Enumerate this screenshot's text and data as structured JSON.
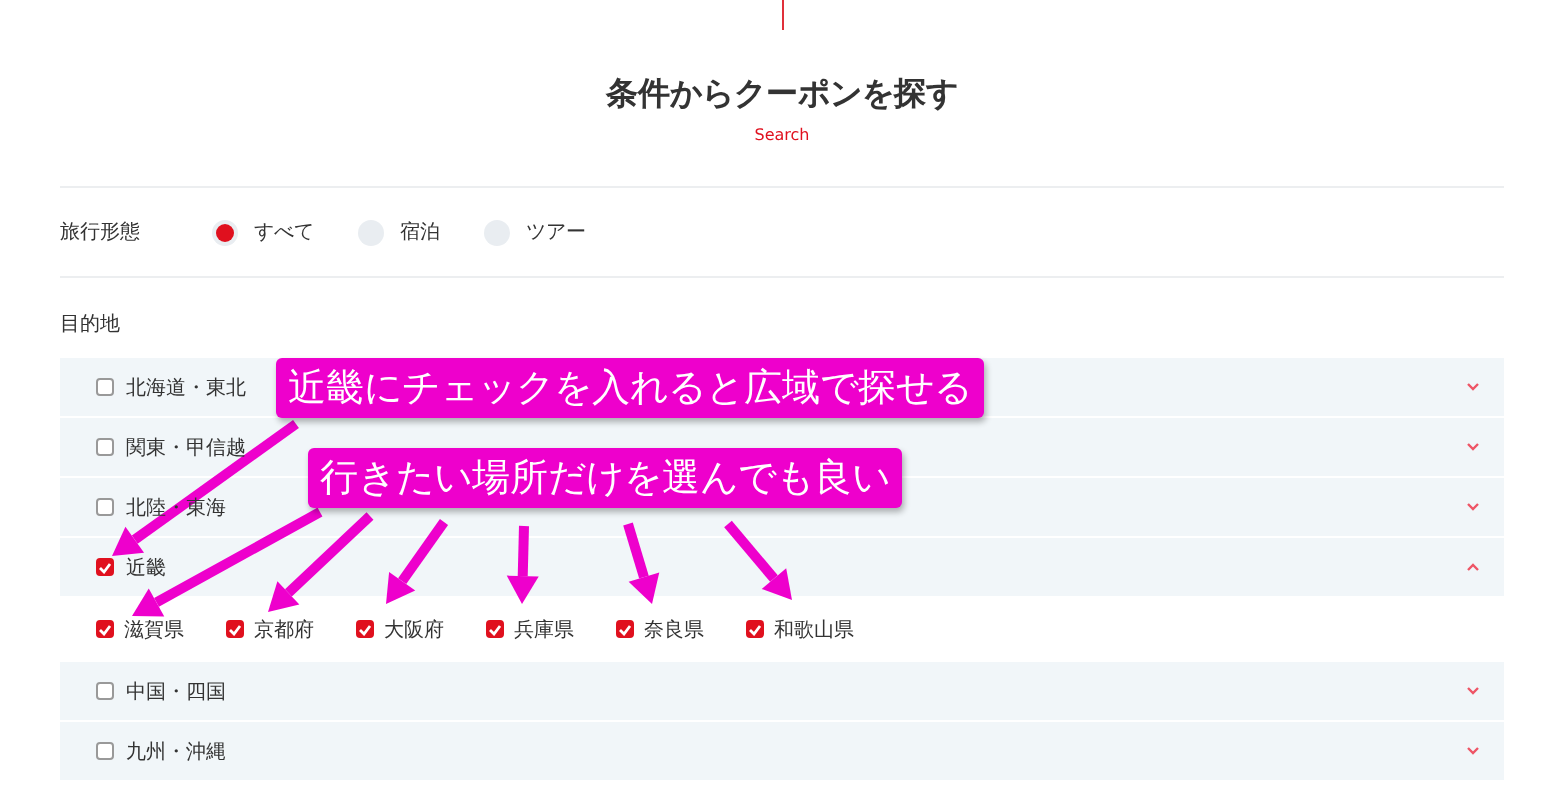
{
  "title": "条件からクーポンを探す",
  "subtitle": "Search",
  "travel_type": {
    "label": "旅行形態",
    "options": [
      {
        "label": "すべて",
        "selected": true
      },
      {
        "label": "宿泊",
        "selected": false
      },
      {
        "label": "ツアー",
        "selected": false
      }
    ]
  },
  "destination": {
    "label": "目的地",
    "regions": [
      {
        "label": "北海道・東北",
        "checked": false,
        "expanded": false
      },
      {
        "label": "関東・甲信越",
        "checked": false,
        "expanded": false
      },
      {
        "label": "北陸・東海",
        "checked": false,
        "expanded": false
      },
      {
        "label": "近畿",
        "checked": true,
        "expanded": true,
        "children": [
          {
            "label": "滋賀県",
            "checked": true
          },
          {
            "label": "京都府",
            "checked": true
          },
          {
            "label": "大阪府",
            "checked": true
          },
          {
            "label": "兵庫県",
            "checked": true
          },
          {
            "label": "奈良県",
            "checked": true
          },
          {
            "label": "和歌山県",
            "checked": true
          }
        ]
      },
      {
        "label": "中国・四国",
        "checked": false,
        "expanded": false
      },
      {
        "label": "九州・沖縄",
        "checked": false,
        "expanded": false
      }
    ]
  },
  "annotations": [
    {
      "text": "近畿にチェックを入れると広域で探せる"
    },
    {
      "text": "行きたい場所だけを選んでも良い"
    }
  ]
}
